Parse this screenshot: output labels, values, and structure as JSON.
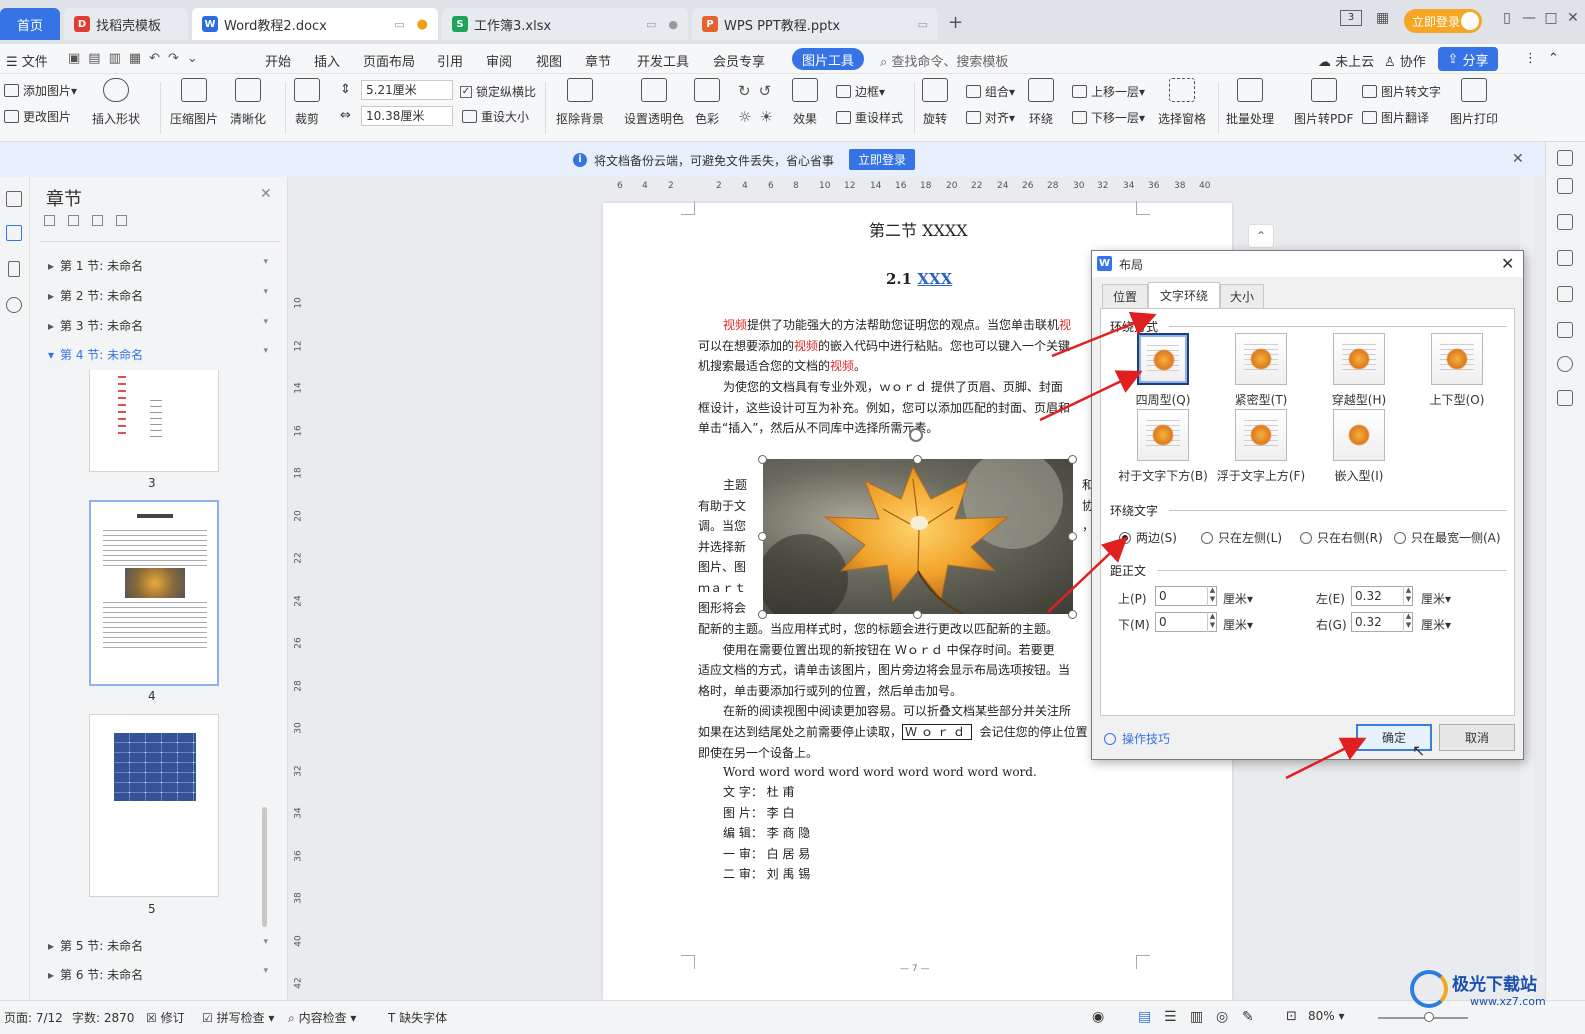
{
  "tabs": [
    {
      "label": "首页",
      "type": "home"
    },
    {
      "label": "找稻壳模板",
      "badge": "D"
    },
    {
      "label": "Word教程2.docx",
      "badge": "W"
    },
    {
      "label": "工作簿3.xlsx",
      "badge": "S"
    },
    {
      "label": "WPS PPT教程.pptx",
      "badge": "P"
    }
  ],
  "titlebar": {
    "login": "立即登录",
    "page_counter": "3"
  },
  "menu": {
    "file": "文件",
    "items": [
      "开始",
      "插入",
      "页面布局",
      "引用",
      "审阅",
      "视图",
      "章节",
      "开发工具",
      "会员专享"
    ],
    "active": "图片工具",
    "search_placeholder": "查找命令、搜索模板",
    "cloud": "未上云",
    "collab": "协作",
    "share": "分享"
  },
  "ribbon": {
    "add_image": "添加图片",
    "change_image": "更改图片",
    "insert_shape": "插入形状",
    "compress": "压缩图片",
    "sharpen": "清晰化",
    "crop": "裁剪",
    "height": "5.21厘米",
    "width": "10.38厘米",
    "lock_ratio": "锁定纵横比",
    "reset_size": "重设大小",
    "remove_bg": "抠除背景",
    "transparent": "设置透明色",
    "color": "色彩",
    "effect": "效果",
    "border": "边框",
    "reset_style": "重设样式",
    "rotate": "旋转",
    "group": "组合",
    "align": "对齐",
    "wrap": "环绕",
    "bring_forward": "上移一层",
    "send_backward": "下移一层",
    "selection_pane": "选择窗格",
    "batch": "批量处理",
    "to_pdf": "图片转PDF",
    "to_text": "图片转文字",
    "translate": "图片翻译",
    "print": "图片打印"
  },
  "notice": {
    "text": "将文档备份云端，可避免文件丢失，省心省事",
    "button": "立即登录"
  },
  "chapter_panel": {
    "title": "章节",
    "sections": [
      "第 1 节: 未命名",
      "第 2 节: 未命名",
      "第 3 节: 未命名",
      "第 4 节: 未命名",
      "第 5 节: 未命名",
      "第 6 节: 未命名"
    ],
    "thumb_numbers": [
      "3",
      "4",
      "5"
    ]
  },
  "ruler": {
    "h_ticks": [
      "6",
      "4",
      "2",
      "2",
      "4",
      "6",
      "8",
      "10",
      "12",
      "14",
      "16",
      "18",
      "20",
      "22",
      "24",
      "26",
      "28",
      "30",
      "32",
      "34",
      "36",
      "38",
      "40"
    ],
    "v_ticks": [
      "10",
      "12",
      "14",
      "16",
      "18",
      "20",
      "22",
      "24",
      "26",
      "28",
      "30",
      "32",
      "34",
      "36",
      "38",
      "40",
      "42",
      "44"
    ]
  },
  "document": {
    "heading": "第二节  XXXX",
    "subheading_prefix": "2.1 ",
    "subheading_link": "XXX",
    "p1_l1a": "视频",
    "p1_l1b": "提供了功能强大的方法帮助您证明您的观点。当您单击联机",
    "p1_l1c": "视",
    "p1_l2a": "可以在想要添加的",
    "p1_l2b": "视频",
    "p1_l2c": "的嵌入代码中进行粘贴。您也可以键入一个关键",
    "p1_l3a": "机搜索最适合您的文档的",
    "p1_l3b": "视频",
    "p1_l3c": "。",
    "p2_l1": "为使您的文档具有专业外观，ｗｏｒｄ  提供了页眉、页脚、封面",
    "p2_l2": "框设计，这些设计可互为补充。例如，您可以添加匹配的封面、页眉和",
    "p2_l3": "单击“插入”，然后从不同库中选择所需元素。",
    "wrap_left": [
      "主题",
      "有助于文",
      "调。当您",
      "并选择新",
      "图片、图",
      "ｍａｒｔ",
      "图形将会"
    ],
    "wrap_right": [
      "和",
      "协",
      "，",
      "。",
      "Ｓ",
      "",
      "匹"
    ],
    "p3_end": "配新的主题。当应用样式时，您的标题会进行更改以匹配新的主题。",
    "p4_l1": "使用在需要位置出现的新按钮在  Ｗｏｒｄ  中保存时间。若要更",
    "p4_l2": "适应文档的方式，请单击该图片，图片旁边将会显示布局选项按钮。当",
    "p4_l3": "格时，单击要添加行或列的位置，然后单击加号。",
    "p5_l1": "在新的阅读视图中阅读更加容易。可以折叠文档某些部分并关注所",
    "p5_l2a": "如果在达到结尾处之前需要停止读取，",
    "p5_l2b": "Ｗｏｒｄ",
    "p5_l2c": "会记住您的停止位置",
    "p5_l3": "即使在另一个设备上。",
    "p6": "Word word word word word word word word word.",
    "credits": [
      "文 字： 杜     甫",
      "图 片： 李     白",
      "编 辑： 李 商 隐",
      "一 审： 白 居 易",
      "二 审： 刘 禹 锡"
    ],
    "page_number": "— 7 —"
  },
  "dialog": {
    "title": "布局",
    "tabs": [
      "位置",
      "文字环绕",
      "大小"
    ],
    "wrap_style_label": "环绕方式",
    "wrap_options": [
      "四周型(Q)",
      "紧密型(T)",
      "穿越型(H)",
      "上下型(O)",
      "衬于文字下方(B)",
      "浮于文字上方(F)",
      "嵌入型(I)"
    ],
    "wrap_text_label": "环绕文字",
    "wrap_text_options": [
      "两边(S)",
      "只在左侧(L)",
      "只在右侧(R)",
      "只在最宽一侧(A)"
    ],
    "distance_label": "距正文",
    "top_label": "上(P)",
    "top_value": "0",
    "bottom_label": "下(M)",
    "bottom_value": "0",
    "left_label": "左(E)",
    "left_value": "0.32",
    "right_label": "右(G)",
    "right_value": "0.32",
    "unit": "厘米",
    "tips": "操作技巧",
    "ok": "确定",
    "cancel": "取消"
  },
  "statusbar": {
    "page": "页面: 7/12",
    "words": "字数: 2870",
    "revise": "修订",
    "spell": "拼写检查",
    "content": "内容检查",
    "font": "缺失字体",
    "zoom": "80%"
  },
  "watermark": {
    "name": "极光下载站",
    "url": "www.xz7.com"
  },
  "colors": {
    "accent": "#3573e6",
    "arrow": "#e02020",
    "tab_bar": "#dfe3e8"
  }
}
